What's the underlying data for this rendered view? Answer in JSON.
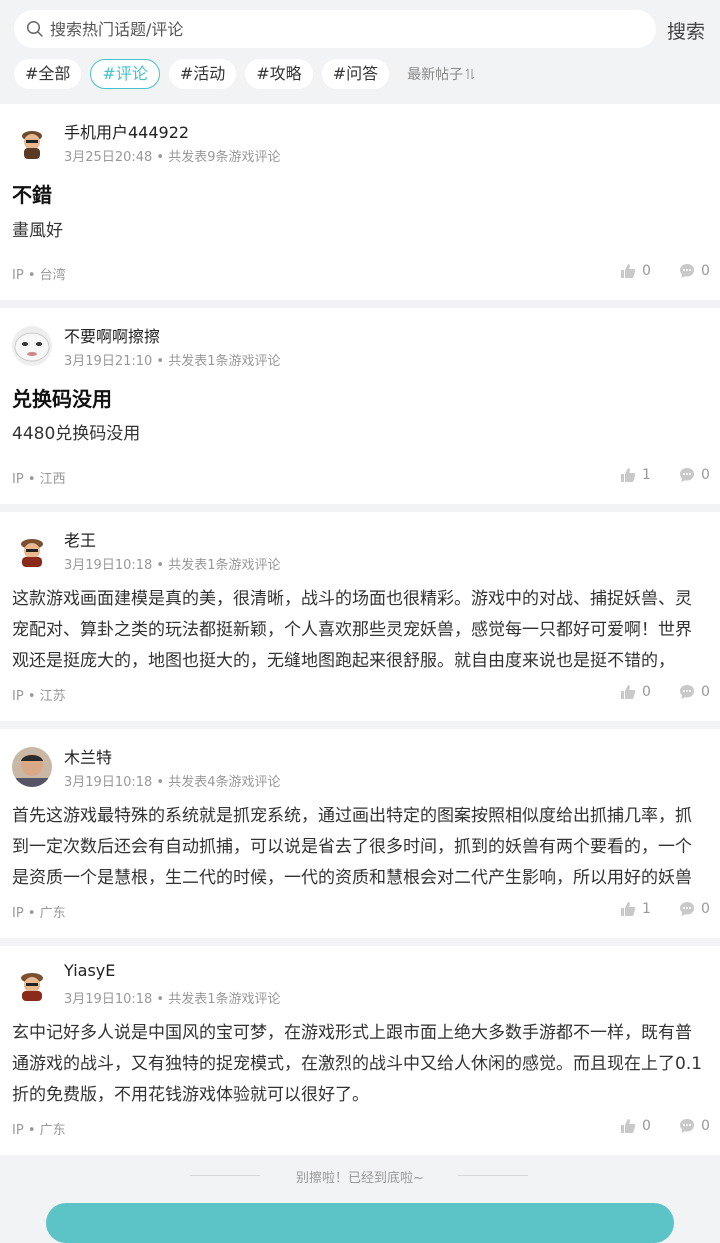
{
  "search": {
    "placeholder": "搜索热门话题/评论",
    "button_label": "搜索",
    "icon": "search-icon"
  },
  "tags": [
    "#全部",
    "#评论",
    "#活动",
    "#攻略",
    "#问答"
  ],
  "active_tag": "#评论",
  "sort_label": "最新帖子",
  "accent_color": "#47c1c8",
  "posts": [
    {
      "username": "手机用户444922",
      "time": "3月25日20:48",
      "count": "共发表9条游戏评论",
      "title": "不錯",
      "body": "畫風好",
      "ip_label": "IP",
      "ip": "台湾",
      "likes": "0",
      "comments": "0"
    },
    {
      "username": "不要啊啊擦擦",
      "time": "3月19日21:10",
      "count": "共发表1条游戏评论",
      "title": "兑换码没用",
      "body": "4480兑换码没用",
      "ip_label": "IP",
      "ip": "江西",
      "likes": "1",
      "comments": "0"
    },
    {
      "username": "老王",
      "time": "3月19日10:18",
      "count": "共发表1条游戏评论",
      "body": "这款游戏画面建模是真的美，很清晰，战斗的场面也很精彩。游戏中的对战、捕捉妖兽、灵宠配对、算卦之类的玩法都挺新颖，个人喜欢那些灵宠妖兽，感觉每一只都好可爱啊！世界观还是挺庞大的，地图也挺大的，无缝地图跑起来很舒服。就自由度来说也是挺不错的，",
      "ip_label": "IP",
      "ip": "江苏",
      "likes": "0",
      "comments": "0"
    },
    {
      "username": "木兰特",
      "time": "3月19日10:18",
      "count": "共发表4条游戏评论",
      "body": "首先这游戏最特殊的系统就是抓宠系统，通过画出特定的图案按照相似度给出抓捕几率，抓到一定次数后还会有自动抓捕，可以说是省去了很多时间，抓到的妖兽有两个要看的，一个是资质一个是慧根，生二代的时候，一代的资质和慧根会对二代产生影响，所以用好的妖兽",
      "ip_label": "IP",
      "ip": "广东",
      "likes": "1",
      "comments": "0"
    },
    {
      "username": "YiasyE",
      "time": "3月19日10:18",
      "count": "共发表1条游戏评论",
      "body": "玄中记好多人说是中国风的宝可梦，在游戏形式上跟市面上绝大多数手游都不一样，既有普通游戏的战斗，又有独特的捉宠模式，在激烈的战斗中又给人休闲的感觉。而且现在上了0.1折的免费版，不用花钱游戏体验就可以很好了。",
      "ip_label": "IP",
      "ip": "广东",
      "likes": "0",
      "comments": "0"
    }
  ],
  "footer": "别擦啦！已经到底啦~"
}
